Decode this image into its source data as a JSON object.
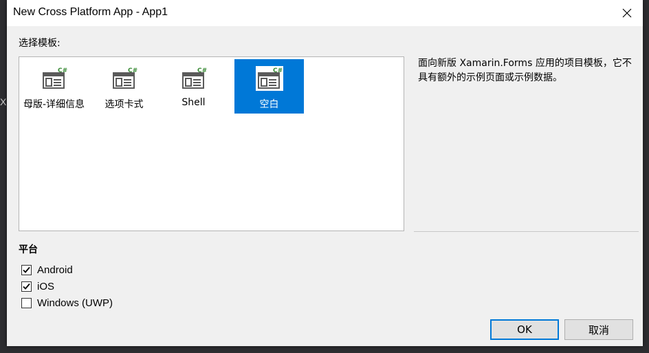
{
  "background_peek": "Xa",
  "dialog": {
    "title": "New Cross Platform App - App1"
  },
  "templates": {
    "label": "选择模板:",
    "items": [
      {
        "label": "母版-详细信息",
        "icon": "template-csharp-icon",
        "selected": false
      },
      {
        "label": "选项卡式",
        "icon": "template-csharp-icon",
        "selected": false
      },
      {
        "label": "Shell",
        "icon": "template-csharp-icon",
        "selected": false
      },
      {
        "label": "空白",
        "icon": "template-csharp-icon",
        "selected": true
      }
    ],
    "icon_badge": "C#"
  },
  "description": "面向新版 Xamarin.Forms 应用的项目模板，它不具有额外的示例页面或示例数据。",
  "platform": {
    "label": "平台",
    "options": [
      {
        "label": "Android",
        "checked": true
      },
      {
        "label": "iOS",
        "checked": true
      },
      {
        "label": "Windows (UWP)",
        "checked": false
      }
    ]
  },
  "buttons": {
    "ok": "OK",
    "cancel": "取消"
  },
  "colors": {
    "selection": "#0078d7",
    "csharp_badge": "#388a34"
  }
}
